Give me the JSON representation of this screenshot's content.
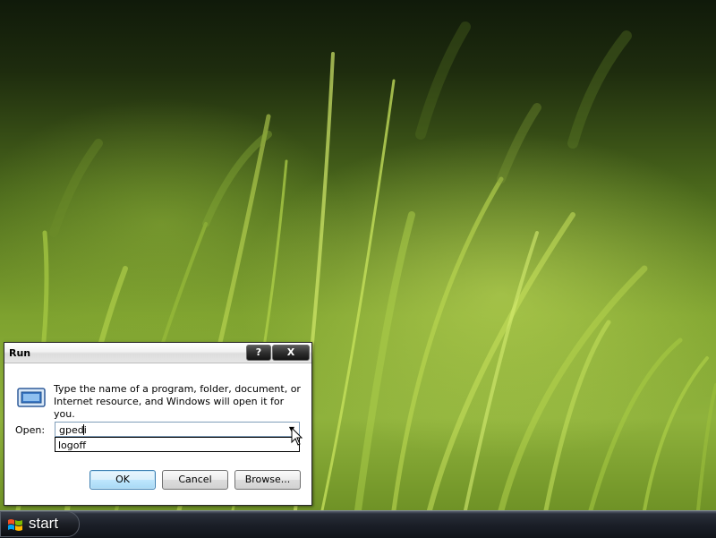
{
  "desktop": {
    "wallpaper": "green grass close-up"
  },
  "run_dialog": {
    "title": "Run",
    "help_button": "?",
    "close_button": "X",
    "description_line1": "Type the name of a program, folder, document, or",
    "description_line2": "Internet resource, and Windows will open it for you.",
    "open_label": "Open:",
    "open_value": "gpedi",
    "dropdown_items": [
      "logoff"
    ],
    "buttons": {
      "ok": "OK",
      "cancel": "Cancel",
      "browse": "Browse..."
    },
    "icon": "run-program-icon"
  },
  "taskbar": {
    "start_label": "start",
    "start_icon": "windows-logo-icon"
  },
  "colors": {
    "ok_button_accent": "#3c7fb1",
    "taskbar": "#1b1f28"
  }
}
